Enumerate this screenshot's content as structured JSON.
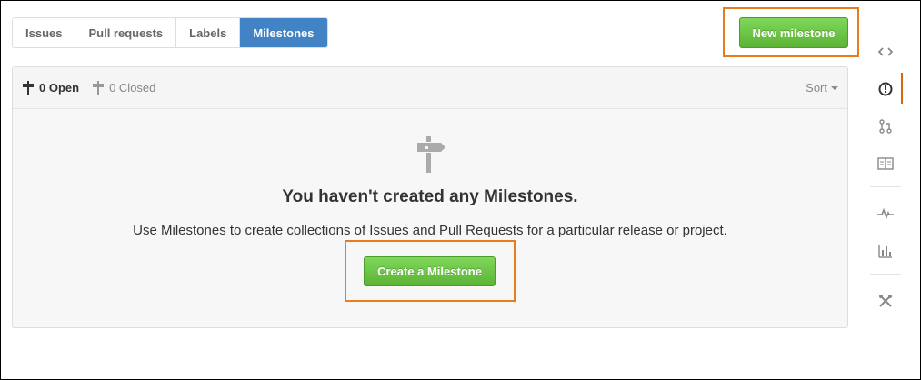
{
  "subnav": {
    "tabs": [
      {
        "label": "Issues"
      },
      {
        "label": "Pull requests"
      },
      {
        "label": "Labels"
      },
      {
        "label": "Milestones"
      }
    ],
    "active": "Milestones"
  },
  "new_milestone_label": "New milestone",
  "filters": {
    "open": "0 Open",
    "closed": "0 Closed",
    "sort": "Sort"
  },
  "blankslate": {
    "icon": "milestone-icon",
    "title": "You haven't created any Milestones.",
    "description": "Use Milestones to create collections of Issues and Pull Requests for a particular release or project.",
    "cta_label": "Create a Milestone"
  },
  "sidebar": {
    "items": [
      {
        "icon": "code-icon"
      },
      {
        "icon": "issue-opened-icon",
        "active": true
      },
      {
        "icon": "pull-request-icon"
      },
      {
        "icon": "wiki-icon"
      },
      {
        "icon": "pulse-icon"
      },
      {
        "icon": "graph-icon"
      },
      {
        "icon": "settings-icon"
      }
    ]
  },
  "colors": {
    "accent_blue": "#4183c4",
    "button_green": "#6cc644",
    "highlight_orange": "#e87c1e",
    "sidebar_active": "#d26911"
  }
}
